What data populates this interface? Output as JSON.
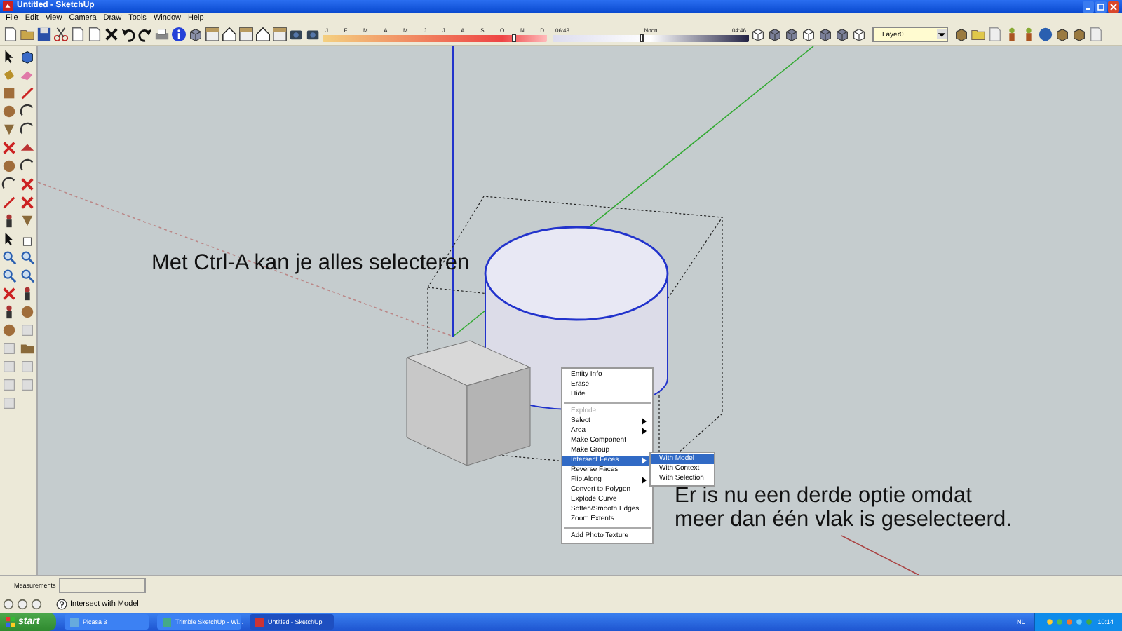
{
  "window": {
    "title": "Untitled - SketchUp"
  },
  "menu_bar": [
    "File",
    "Edit",
    "View",
    "Camera",
    "Draw",
    "Tools",
    "Window",
    "Help"
  ],
  "toolbar": {
    "month_slider": {
      "labels": [
        "J",
        "F",
        "M",
        "A",
        "M",
        "J",
        "J",
        "A",
        "S",
        "O",
        "N",
        "D"
      ],
      "level": 0.85
    },
    "time_slider": {
      "labels": [
        "06:43",
        "Noon",
        "04:46"
      ],
      "level": 0.45
    },
    "layer_select": {
      "value": "Layer0"
    }
  },
  "viewport": {
    "annotations": [
      {
        "text": "Met Ctrl-A kan je alles selecteren",
        "kind": "upper"
      },
      {
        "text": "Er is nu een derde optie omdat meer dan één vlak is geselecteerd.",
        "kind": "lower"
      }
    ]
  },
  "context_menu": {
    "items": [
      {
        "kind": "item",
        "label": "Entity Info",
        "disabled": false,
        "submenu": false,
        "selected": false
      },
      {
        "kind": "item",
        "label": "Erase",
        "disabled": false,
        "submenu": false,
        "selected": false
      },
      {
        "kind": "item",
        "label": "Hide",
        "disabled": false,
        "submenu": false,
        "selected": false
      },
      {
        "kind": "separator"
      },
      {
        "kind": "item",
        "label": "Explode",
        "disabled": true,
        "submenu": false,
        "selected": false
      },
      {
        "kind": "item",
        "label": "Select",
        "disabled": false,
        "submenu": true,
        "selected": false
      },
      {
        "kind": "item",
        "label": "Area",
        "disabled": false,
        "submenu": true,
        "selected": false
      },
      {
        "kind": "item",
        "label": "Make Component",
        "disabled": false,
        "submenu": false,
        "selected": false
      },
      {
        "kind": "item",
        "label": "Make Group",
        "disabled": false,
        "submenu": false,
        "selected": false
      },
      {
        "kind": "item",
        "label": "Intersect Faces",
        "disabled": false,
        "submenu": true,
        "selected": true
      },
      {
        "kind": "item",
        "label": "Reverse Faces",
        "disabled": false,
        "submenu": false,
        "selected": false
      },
      {
        "kind": "item",
        "label": "Flip Along",
        "disabled": false,
        "submenu": true,
        "selected": false
      },
      {
        "kind": "item",
        "label": "Convert to Polygon",
        "disabled": false,
        "submenu": false,
        "selected": false
      },
      {
        "kind": "item",
        "label": "Explode Curve",
        "disabled": false,
        "submenu": false,
        "selected": false
      },
      {
        "kind": "item",
        "label": "Soften/Smooth Edges",
        "disabled": false,
        "submenu": false,
        "selected": false
      },
      {
        "kind": "item",
        "label": "Zoom Extents",
        "disabled": false,
        "submenu": false,
        "selected": false
      },
      {
        "kind": "separator"
      },
      {
        "kind": "item",
        "label": "Add Photo Texture",
        "disabled": false,
        "submenu": false,
        "selected": false
      }
    ],
    "submenu": [
      {
        "label": "With Model",
        "selected": true
      },
      {
        "label": "With Context",
        "selected": false
      },
      {
        "label": "With Selection",
        "selected": false
      }
    ]
  },
  "measurements": {
    "label": "Measurements"
  },
  "status_bar": {
    "text": "Intersect with Model"
  },
  "taskbar": {
    "start": "start",
    "tasks": [
      {
        "label": "Picasa 3",
        "selected": false
      },
      {
        "label": "Trimble SketchUp - Wi...",
        "selected": false
      },
      {
        "label": "Untitled - SketchUp",
        "selected": true
      }
    ],
    "language": "NL",
    "clock": "10:14"
  }
}
